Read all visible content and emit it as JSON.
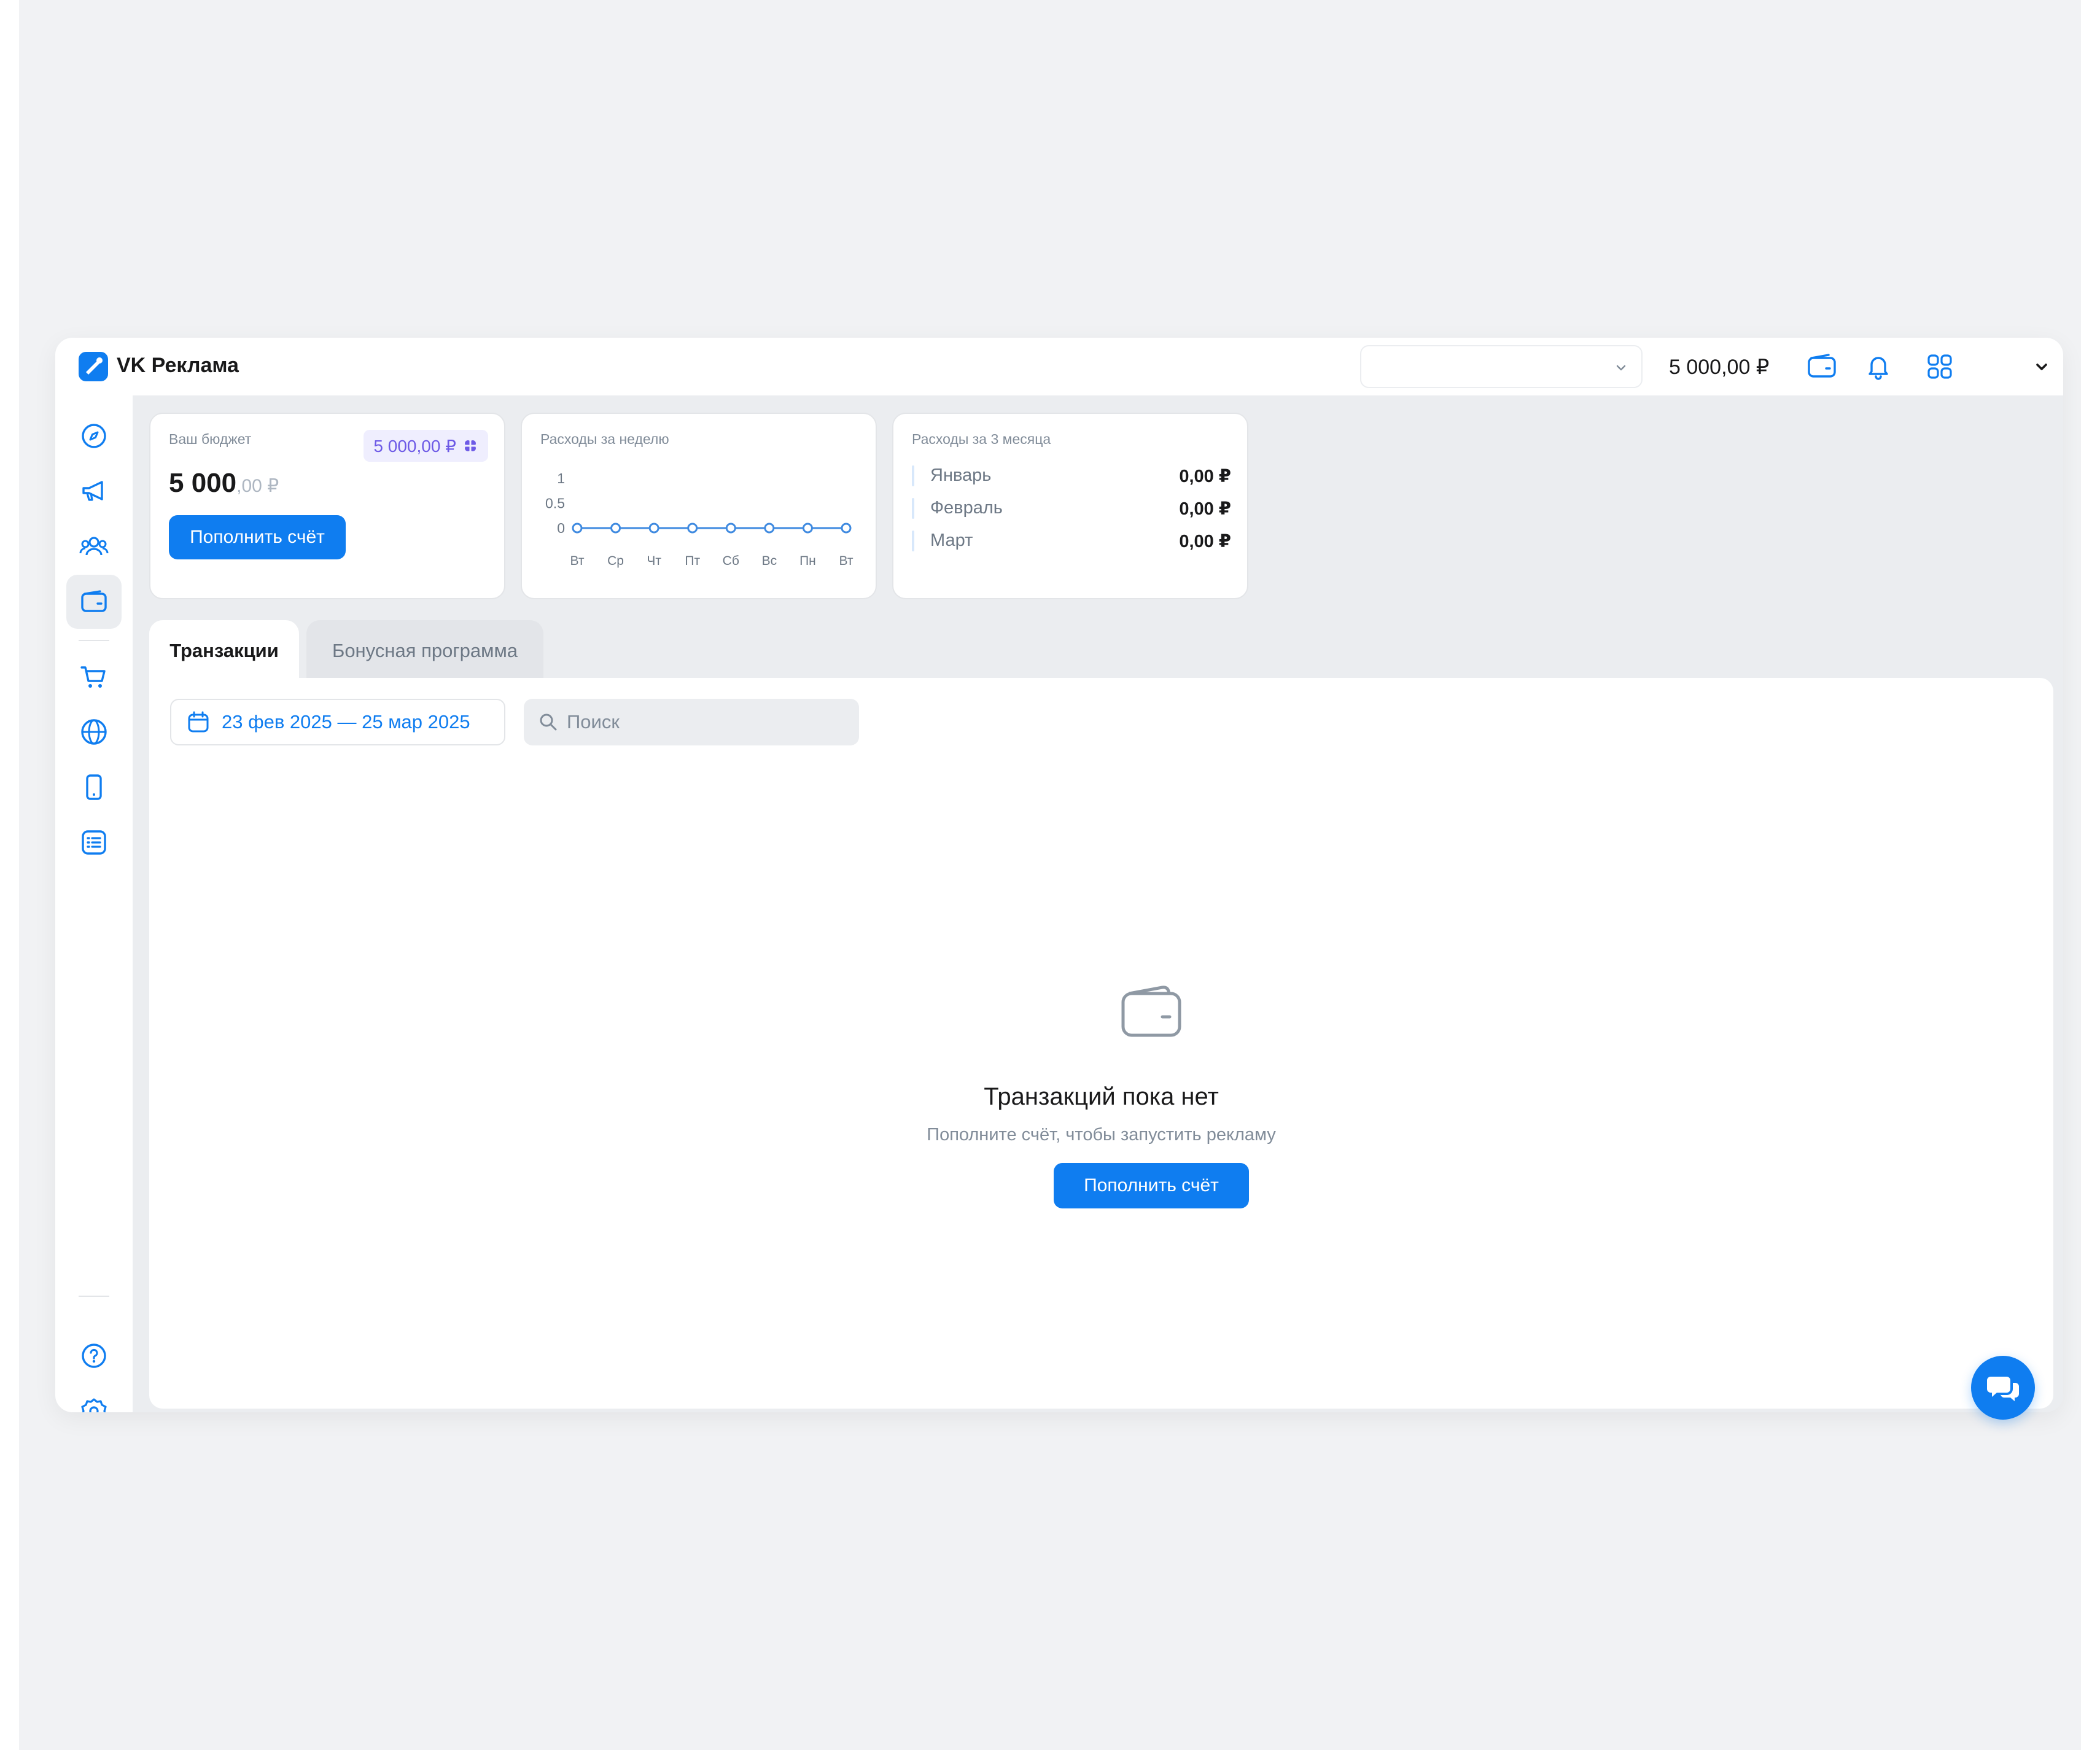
{
  "header": {
    "app_title": "VK Реклама",
    "account_select_value": "",
    "balance": "5 000,00 ₽"
  },
  "cards": {
    "budget": {
      "label": "Ваш бюджет",
      "bonus": "5 000,00 ₽",
      "amount_int": "5 000",
      "amount_dec": ",00 ₽",
      "button": "Пополнить счёт"
    },
    "week": {
      "label": "Расходы за неделю"
    },
    "months": {
      "label": "Расходы за 3 месяца",
      "rows": [
        {
          "name": "Январь",
          "value": "0,00 ₽"
        },
        {
          "name": "Февраль",
          "value": "0,00 ₽"
        },
        {
          "name": "Март",
          "value": "0,00 ₽"
        }
      ]
    }
  },
  "chart_data": {
    "type": "line",
    "categories": [
      "Вт",
      "Ср",
      "Чт",
      "Пт",
      "Сб",
      "Вс",
      "Пн",
      "Вт"
    ],
    "series": [
      {
        "values": [
          0,
          0,
          0,
          0,
          0,
          0,
          0,
          0
        ]
      }
    ],
    "y_ticks": [
      "1",
      "0.5",
      "0"
    ],
    "ylim": [
      0,
      1
    ],
    "title": "",
    "xlabel": "",
    "ylabel": "",
    "grid": false,
    "color": "#3f8ae0"
  },
  "tabs": [
    {
      "label": "Транзакции",
      "active": true
    },
    {
      "label": "Бонусная программа",
      "active": false
    }
  ],
  "filters": {
    "date_range": "23 фев 2025 — 25 мар 2025",
    "search_placeholder": "Поиск"
  },
  "empty_state": {
    "title": "Транзакций пока нет",
    "subtitle": "Пополните счёт, чтобы запустить рекламу",
    "button": "Пополнить счёт"
  },
  "colors": {
    "accent": "#0f7df0",
    "bonus": "#6d5ae6"
  }
}
